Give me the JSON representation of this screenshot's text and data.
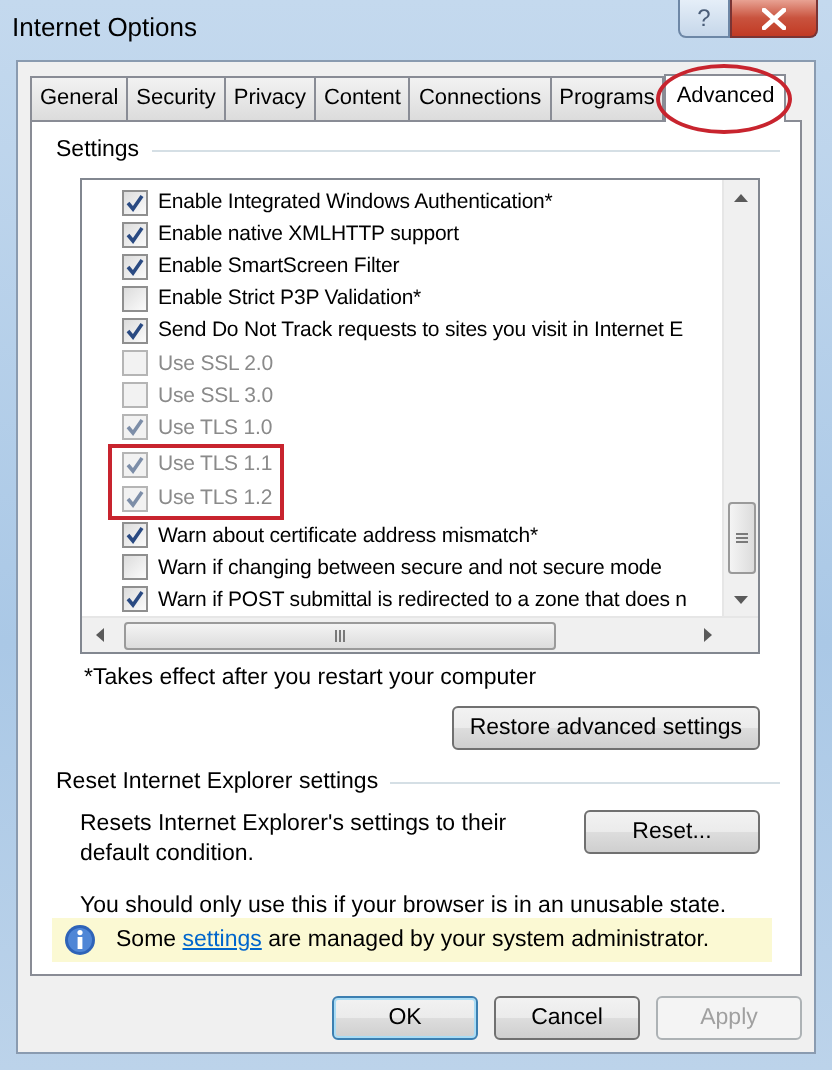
{
  "window": {
    "title": "Internet Options",
    "help_button": "?"
  },
  "tabs": [
    {
      "label": "General",
      "selected": false,
      "annotated": false
    },
    {
      "label": "Security",
      "selected": false,
      "annotated": false
    },
    {
      "label": "Privacy",
      "selected": false,
      "annotated": false
    },
    {
      "label": "Content",
      "selected": false,
      "annotated": false
    },
    {
      "label": "Connections",
      "selected": false,
      "annotated": false
    },
    {
      "label": "Programs",
      "selected": false,
      "annotated": false
    },
    {
      "label": "Advanced",
      "selected": true,
      "annotated": true
    }
  ],
  "settings": {
    "heading": "Settings",
    "items": [
      {
        "label": "Enable Integrated Windows Authentication*",
        "checked": true,
        "disabled": false,
        "annotated": false
      },
      {
        "label": "Enable native XMLHTTP support",
        "checked": true,
        "disabled": false,
        "annotated": false
      },
      {
        "label": "Enable SmartScreen Filter",
        "checked": true,
        "disabled": false,
        "annotated": false
      },
      {
        "label": "Enable Strict P3P Validation*",
        "checked": false,
        "disabled": false,
        "annotated": false
      },
      {
        "label": "Send Do Not Track requests to sites you visit in Internet E",
        "checked": true,
        "disabled": false,
        "annotated": false
      },
      {
        "label": "Use SSL 2.0",
        "checked": false,
        "disabled": true,
        "annotated": false
      },
      {
        "label": "Use SSL 3.0",
        "checked": false,
        "disabled": true,
        "annotated": false
      },
      {
        "label": "Use TLS 1.0",
        "checked": true,
        "disabled": true,
        "annotated": false
      },
      {
        "label": "Use TLS 1.1",
        "checked": true,
        "disabled": true,
        "annotated": true
      },
      {
        "label": "Use TLS 1.2",
        "checked": true,
        "disabled": true,
        "annotated": true
      },
      {
        "label": "Warn about certificate address mismatch*",
        "checked": true,
        "disabled": false,
        "annotated": false
      },
      {
        "label": "Warn if changing between secure and not secure mode",
        "checked": false,
        "disabled": false,
        "annotated": false
      },
      {
        "label": "Warn if POST submittal is redirected to a zone that does n",
        "checked": true,
        "disabled": false,
        "annotated": false
      }
    ],
    "note": "*Takes effect after you restart your computer",
    "restore_button": "Restore advanced settings"
  },
  "reset": {
    "heading": "Reset Internet Explorer settings",
    "description": "Resets Internet Explorer's settings to their default condition.",
    "button": "Reset...",
    "warning": "You should only use this if your browser is in an unusable state."
  },
  "info_bar": {
    "before": "Some ",
    "link": "settings",
    "after": " are managed by your system administrator."
  },
  "buttons": [
    {
      "label": "OK",
      "disabled": false,
      "default": true
    },
    {
      "label": "Cancel",
      "disabled": false,
      "default": false
    },
    {
      "label": "Apply",
      "disabled": true,
      "default": false
    }
  ]
}
